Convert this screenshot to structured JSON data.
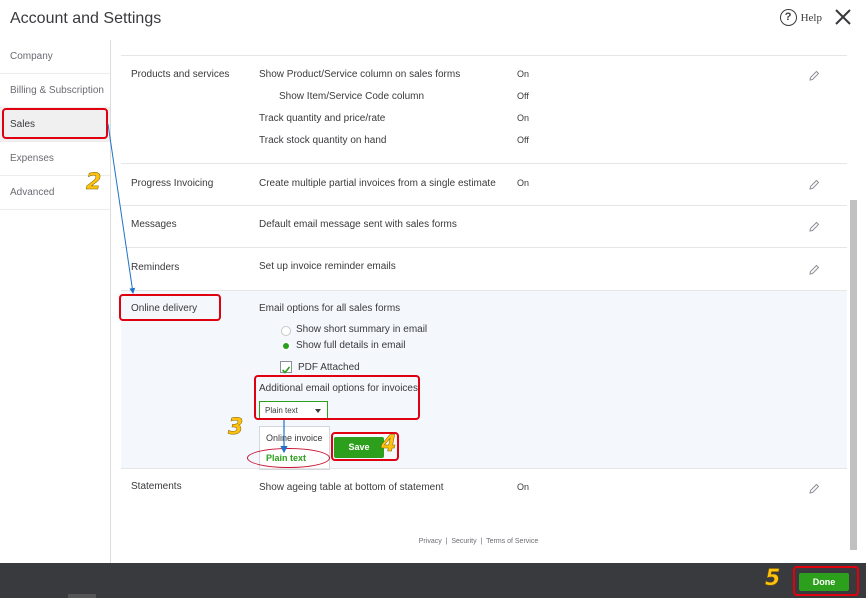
{
  "header": {
    "title": "Account and Settings",
    "help_label": "Help"
  },
  "sidebar": {
    "items": [
      {
        "label": "Company"
      },
      {
        "label": "Billing & Subscription"
      },
      {
        "label": "Sales"
      },
      {
        "label": "Expenses"
      },
      {
        "label": "Advanced"
      }
    ],
    "active": "Sales"
  },
  "sections": {
    "products": {
      "label": "Products and services",
      "options": [
        {
          "desc": "Show Product/Service column on sales forms",
          "value": "On"
        },
        {
          "desc": "Show Item/Service Code column",
          "value": "Off"
        },
        {
          "desc": "Track quantity and price/rate",
          "value": "On"
        },
        {
          "desc": "Track stock quantity on hand",
          "value": "Off"
        }
      ]
    },
    "progress": {
      "label": "Progress Invoicing",
      "desc": "Create multiple partial invoices from a single estimate",
      "value": "On"
    },
    "messages": {
      "label": "Messages",
      "desc": "Default email message sent with sales forms"
    },
    "reminders": {
      "label": "Reminders",
      "desc": "Set up invoice reminder emails"
    },
    "online": {
      "label": "Online delivery",
      "desc": "Email options for all sales forms",
      "radio_summary": "Show short summary in email",
      "radio_full": "Show full details in email",
      "selected_radio": "Show full details in email",
      "pdf_label": "PDF Attached",
      "pdf_checked": true,
      "additional_label": "Additional email options for invoices",
      "dropdown_value": "Plain text",
      "dropdown_options": [
        "Online invoice",
        "Plain text"
      ],
      "save_label": "Save"
    },
    "statements": {
      "label": "Statements",
      "desc": "Show ageing table at bottom of statement",
      "value": "On"
    }
  },
  "footer": {
    "privacy": "Privacy",
    "security": "Security",
    "terms": "Terms of Service",
    "sep": "|"
  },
  "bottom": {
    "done_label": "Done"
  },
  "annotations": {
    "step2": "2",
    "step3": "3",
    "step4": "4",
    "step5": "5"
  },
  "colors": {
    "accent": "#2ca01c",
    "annotation_red": "#e10010",
    "annotation_yellow": "#ffc20e",
    "bottom_bar": "#393a3d"
  }
}
